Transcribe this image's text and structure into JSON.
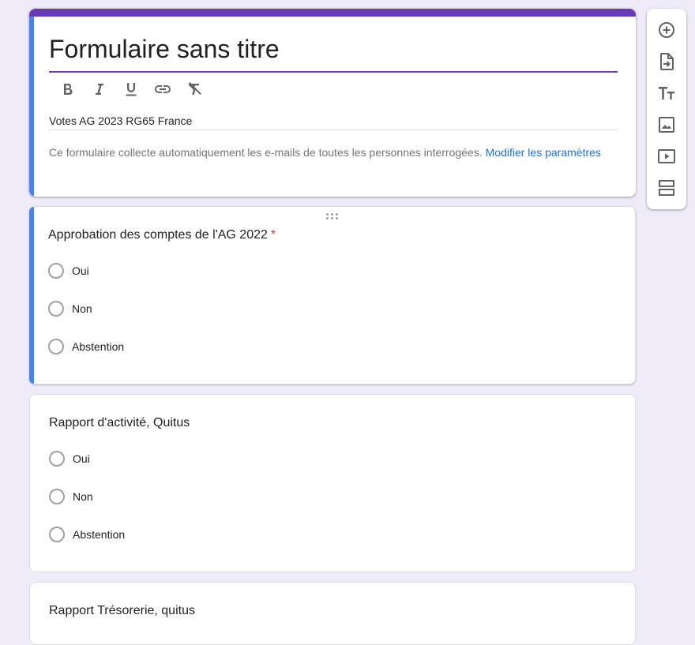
{
  "form": {
    "title": "Formulaire sans titre",
    "description": "Votes AG 2023 RG65 France",
    "notice_text": "Ce formulaire collecte automatiquement les e-mails de toutes les personnes interrogées.",
    "notice_link": "Modifier les paramètres"
  },
  "format_toolbar": [
    "bold-icon",
    "italic-icon",
    "underline-icon",
    "link-icon",
    "clear-format-icon"
  ],
  "questions": [
    {
      "title": "Approbation des comptes de l'AG 2022",
      "required_mark": "*",
      "options": [
        "Oui",
        "Non",
        "Abstention"
      ]
    },
    {
      "title": "Rapport d'activité, Quitus",
      "options": [
        "Oui",
        "Non",
        "Abstention"
      ]
    },
    {
      "title": "Rapport Trésorerie, quitus"
    }
  ],
  "side_toolbar": [
    "add-question-icon",
    "import-questions-icon",
    "add-title-icon",
    "add-image-icon",
    "add-video-icon",
    "add-section-icon"
  ],
  "colors": {
    "accent": "#673ab7",
    "active_bar": "#4285f4",
    "background": "#f0ebf8",
    "link": "#1a73e8",
    "required": "#d93025"
  }
}
